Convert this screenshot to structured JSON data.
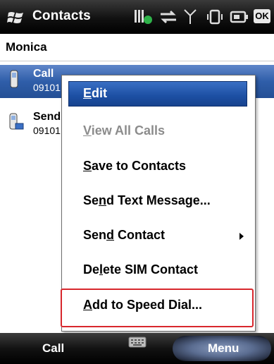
{
  "titlebar": {
    "title": "Contacts",
    "ok_label": "OK",
    "icons": [
      "windows-logo-icon",
      "battery-status-icon",
      "data-connection-icon",
      "signal-icon",
      "vibrate-icon",
      "battery-icon"
    ]
  },
  "contact": {
    "name": "Monica"
  },
  "list": [
    {
      "title": "Call",
      "subtitle": "09101",
      "icon": "phone-icon"
    },
    {
      "title": "Send",
      "subtitle": "09101",
      "icon": "sms-icon"
    }
  ],
  "menu": {
    "items": [
      {
        "label_pre": "",
        "label_u": "E",
        "label_post": "dit",
        "state": "selected"
      },
      {
        "label_pre": "",
        "label_u": "V",
        "label_post": "iew All Calls",
        "state": "disabled"
      },
      {
        "label_pre": "",
        "label_u": "S",
        "label_post": "ave to Contacts",
        "state": "normal"
      },
      {
        "label_pre": "Se",
        "label_u": "n",
        "label_post": "d Text Message...",
        "state": "normal"
      },
      {
        "label_pre": "Sen",
        "label_u": "d",
        "label_post": " Contact",
        "state": "normal",
        "submenu": true
      },
      {
        "label_pre": "De",
        "label_u": "l",
        "label_post": "ete SIM Contact",
        "state": "normal"
      },
      {
        "label_pre": "",
        "label_u": "A",
        "label_post": "dd to Speed Dial...",
        "state": "normal",
        "highlighted": true
      }
    ],
    "highlight_color": "#d8272d"
  },
  "softkeys": {
    "left": "Call",
    "right": "Menu",
    "center_icon": "keyboard-icon"
  },
  "colors": {
    "selection": "#2f5ea9",
    "bar": "#000000"
  }
}
